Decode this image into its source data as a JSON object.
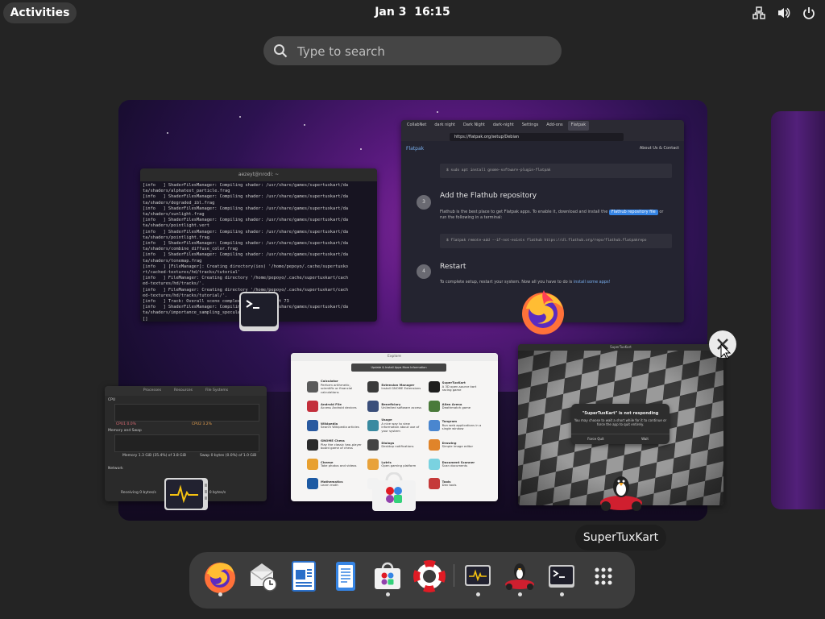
{
  "topbar": {
    "activities_label": "Activities",
    "date": "Jan 3",
    "time": "16:15"
  },
  "search": {
    "placeholder": "Type to search"
  },
  "terminal_window": {
    "title": "aezeyt@nrodi: ~",
    "lines": [
      "[info   ] ShaderFilesManager: Compiling shader: /usr/share/games/supertuxkart/da",
      "ta/shaders/alphatest_particle.frag",
      "[info   ] ShaderFilesManager: Compiling shader: /usr/share/games/supertuxkart/da",
      "ta/shaders/degraded_ibl.frag",
      "[info   ] ShaderFilesManager: Compiling shader: /usr/share/games/supertuxkart/da",
      "ta/shaders/sunlight.frag",
      "[info   ] ShaderFilesManager: Compiling shader: /usr/share/games/supertuxkart/da",
      "ta/shaders/pointlight.vert",
      "[info   ] ShaderFilesManager: Compiling shader: /usr/share/games/supertuxkart/da",
      "ta/shaders/pointlight.frag",
      "[info   ] ShaderFilesManager: Compiling shader: /usr/share/games/supertuxkart/da",
      "ta/shaders/combine_diffuse_color.frag",
      "[info   ] ShaderFilesManager: Compiling shader: /usr/share/games/supertuxkart/da",
      "ta/shaders/tonemap.frag",
      "[info   ] [FileManager]: Creating directory(ies) '/home/pepoyo/.cache/supertuxko",
      "rt/cached-textures/hd/tracks/tutorial'",
      "[info   ] FileManager: Creating directory '/home/pepoyo/.cache/supertuxkart/cach",
      "ed-textures/hd/tracks/'.",
      "[info   ] FileManager: Creating directory '/home/pepoyo/.cache/supertuxkart/cach",
      "ed-textures/hd/tracks/tutorial/'.",
      "[info   ] Track: Overall scene complexity estimated at 73",
      "[info   ] ShaderFilesManager: Compiling shader: /usr/share/games/supertuxkart/da",
      "ta/shaders/importance_sampling_specular.frag",
      "[]"
    ]
  },
  "browser_window": {
    "tabs": [
      "CollabNet",
      "dark night",
      "Dark Night",
      "dark-night",
      "Settings",
      "Add-ons",
      "Flatpak"
    ],
    "url": "https://flatpak.org/setup/Debian",
    "site_name": "Flatpak",
    "top_links": "About Us & Contact",
    "command_1": "$ sudo apt install gnome-software-plugin-flatpak",
    "step_3_number": "3",
    "step_3_heading": "Add the Flathub repository",
    "step_3_text_a": "Flathub is the best place to get Flatpak apps. To enable it, download and install the",
    "step_3_button": "Flathub repository file",
    "step_3_text_b": "or run the following in a terminal:",
    "command_2": "$ flatpak remote-add --if-not-exists flathub https://dl.flathub.org/repo/flathub.flatpakrepo",
    "step_4_number": "4",
    "step_4_heading": "Restart",
    "step_4_text": "To complete setup, restart your system. Now all you have to do is",
    "step_4_link": "install some apps!"
  },
  "sysmon_window": {
    "tabs": [
      "Processes",
      "Resources",
      "File Systems"
    ],
    "cpu_label": "CPU",
    "cpu_legend": [
      "CPU1 0.0%",
      "CPU2 3.2%"
    ],
    "memory_label": "Memory and Swap",
    "memory_text": "Memory 1.3 GiB (35.4%) of 3.8 GiB",
    "swap_text": "Swap 0 bytes (0.0%) of 1.0 GiB",
    "network_label": "Network",
    "receiving_text": "Receiving 0 bytes/s",
    "sending_text": "Sending 0 bytes/s"
  },
  "software_window": {
    "title": "Explore",
    "banner": "Update & Install Apps   More Information",
    "apps": [
      {
        "name": "Calculator",
        "desc": "Perform arithmetic, scientific or financial calculations",
        "color": "#5a5a5a"
      },
      {
        "name": "Extension Manager",
        "desc": "Install GNOME Extensions",
        "color": "#3a3a3a"
      },
      {
        "name": "SuperTuxKart",
        "desc": "A 3D open-source kart racing game",
        "color": "#1e1e1e"
      },
      {
        "name": "Android File",
        "desc": "Access Android devices",
        "color": "#c32f3b"
      },
      {
        "name": "Beneficiary",
        "desc": "Unlimited software access",
        "color": "#3a4e7a"
      },
      {
        "name": "Alien Arena",
        "desc": "Deathmatch game",
        "color": "#4a7a3a"
      },
      {
        "name": "Wikipedia",
        "desc": "Search Wikipedia articles",
        "color": "#2a5aa0"
      },
      {
        "name": "Usage",
        "desc": "A nice way to view information about use of your system",
        "color": "#3a8aa0"
      },
      {
        "name": "Tangram",
        "desc": "Run web applications in a single window",
        "color": "#4a86cf"
      },
      {
        "name": "GNOME Chess",
        "desc": "Play the classic two-player board game of chess",
        "color": "#2b2b2b"
      },
      {
        "name": "Dialogs",
        "desc": "Desktop notifications",
        "color": "#444444"
      },
      {
        "name": "Drawing",
        "desc": "Simple image editor",
        "color": "#e0842a"
      },
      {
        "name": "Cheese",
        "desc": "Take photos and videos",
        "color": "#e8a030"
      },
      {
        "name": "Lutris",
        "desc": "Open gaming platform",
        "color": "#e8a23a"
      },
      {
        "name": "Document Scanner",
        "desc": "Scan documents",
        "color": "#7ad2e0"
      },
      {
        "name": "Mathematics",
        "desc": "Learn math",
        "color": "#1d5aa3"
      },
      {
        "name": "Scratch",
        "desc": "Program games",
        "color": "#f2f2f2"
      },
      {
        "name": "Tools",
        "desc": "Dev tools",
        "color": "#c53a3a"
      }
    ]
  },
  "kart_window": {
    "title": "SuperTuxKart",
    "dialog_title": "\"SuperTuxKart\" is not responding",
    "dialog_desc": "You may choose to wait a short while for it to continue or force the app to quit entirely.",
    "force_quit": "Force Quit",
    "wait": "Wait"
  },
  "tooltip": "SuperTuxKart",
  "dash": {
    "items": [
      {
        "name": "Firefox",
        "running": true
      },
      {
        "name": "Evolution Mail",
        "running": false
      },
      {
        "name": "LibreOffice Writer",
        "running": false
      },
      {
        "name": "Text Editor",
        "running": false
      },
      {
        "name": "Software",
        "running": true
      },
      {
        "name": "Help",
        "running": false
      },
      {
        "name": "System Monitor",
        "running": true
      },
      {
        "name": "SuperTuxKart",
        "running": true
      },
      {
        "name": "Terminal",
        "running": true
      },
      {
        "name": "Show Apps",
        "running": false
      }
    ]
  },
  "colors": {
    "panel_bg": "#242424",
    "search_bg": "#454545",
    "dash_bg": "#3c3c3c",
    "accent": "#3584e4",
    "wallpaper_purple": "#6a1e8a"
  },
  "icons": [
    "search-icon",
    "network-icon",
    "volume-icon",
    "power-icon",
    "close-icon",
    "terminal-icon",
    "firefox-icon",
    "sysmon-icon",
    "software-icon"
  ]
}
